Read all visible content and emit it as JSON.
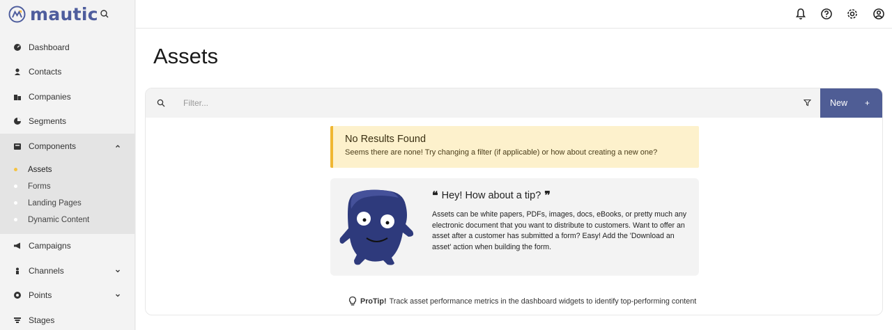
{
  "brand": {
    "name": "mautic"
  },
  "sidebar": {
    "items": [
      {
        "label": "Dashboard",
        "icon": "dashboard-icon"
      },
      {
        "label": "Contacts",
        "icon": "user-icon"
      },
      {
        "label": "Companies",
        "icon": "building-icon"
      },
      {
        "label": "Segments",
        "icon": "pie-chart-icon"
      },
      {
        "label": "Components",
        "icon": "components-icon",
        "expanded": true
      },
      {
        "label": "Campaigns",
        "icon": "megaphone-icon"
      },
      {
        "label": "Channels",
        "icon": "channels-icon",
        "has_children": true
      },
      {
        "label": "Points",
        "icon": "points-icon",
        "has_children": true
      },
      {
        "label": "Stages",
        "icon": "stages-icon"
      }
    ],
    "components_subitems": [
      {
        "label": "Assets",
        "active": true
      },
      {
        "label": "Forms"
      },
      {
        "label": "Landing Pages"
      },
      {
        "label": "Dynamic Content"
      }
    ]
  },
  "topbar": {
    "icons": [
      "bell-icon",
      "help-icon",
      "gear-icon",
      "account-icon"
    ]
  },
  "page": {
    "title": "Assets"
  },
  "filter": {
    "placeholder": "Filter...",
    "new_label": "New",
    "new_icon": "plus-icon"
  },
  "alert": {
    "title": "No Results Found",
    "text": "Seems there are none! Try changing a filter (if applicable) or how about creating a new one?"
  },
  "tip": {
    "heading": "Hey! How about a tip?",
    "body": "Assets can be white papers, PDFs, images, docs, eBooks, or pretty much any electronic document that you want to distribute to customers. Want to offer an asset after a customer has submitted a form? Easy! Add the 'Download an asset' action when building the form."
  },
  "protip": {
    "label": "ProTip!",
    "text": "Track asset performance metrics in the dashboard widgets to identify top-performing content"
  },
  "colors": {
    "brand": "#4f5d95",
    "alert_bg": "#fdf1cc",
    "alert_border": "#f0b732",
    "active_dot": "#f5c342"
  }
}
